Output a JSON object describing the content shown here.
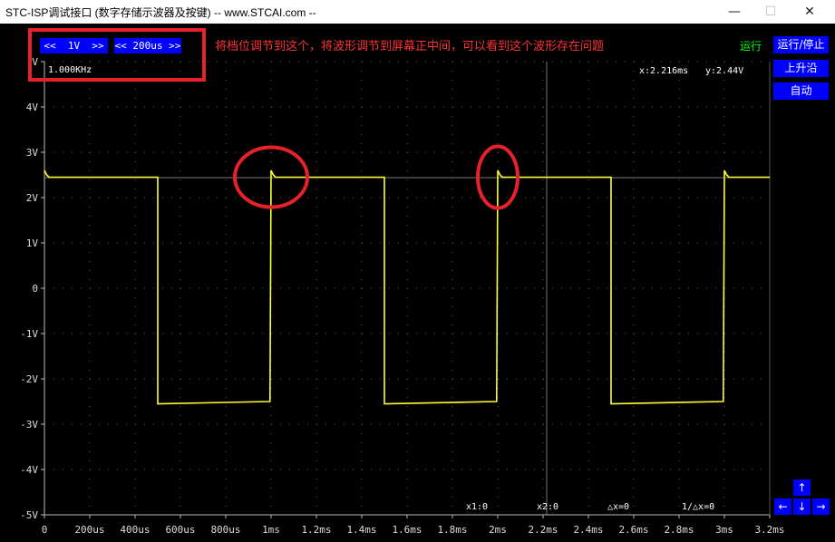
{
  "window": {
    "title": "STC-ISP调试接口 (数字存储示波器及按键) -- www.STCAI.com --",
    "minimize": "—",
    "maximize": "☐",
    "close": "✕"
  },
  "controls": {
    "volt_div": "<<  1V  >>",
    "time_div": "<< 200us >>"
  },
  "annotation": "将档位调节到这个，将波形调节到屏幕正中间，可以看到这个波形存在问题",
  "status": "运行",
  "side_buttons": {
    "run_stop": "运行/停止",
    "edge": "上升沿",
    "auto": "自动"
  },
  "arrows": {
    "up": "↑",
    "left": "←",
    "down": "↓",
    "right": "→"
  },
  "readouts": {
    "frequency": "1.000KHz",
    "x": "x:2.216ms",
    "y": "y:2.44V",
    "x1": "x1:0",
    "x2": "x2:0",
    "dx": "△x=0",
    "inv_dx": "1/△x=0"
  },
  "colors": {
    "trace": "#ffff33",
    "grid": "#5a5a5a",
    "button": "#0000ff",
    "highlight": "#e8212b",
    "status": "#00ff00"
  },
  "chart_data": {
    "type": "line",
    "title": "",
    "xlabel": "",
    "ylabel": "",
    "y_unit_label": "V",
    "xlim": [
      0,
      3.2
    ],
    "ylim": [
      -5,
      5
    ],
    "x_ticks": [
      "0",
      "200us",
      "400us",
      "600us",
      "800us",
      "1ms",
      "1.2ms",
      "1.4ms",
      "1.6ms",
      "1.8ms",
      "2ms",
      "2.2ms",
      "2.4ms",
      "2.6ms",
      "2.8ms",
      "3ms",
      "3.2ms"
    ],
    "y_ticks": [
      "-5V",
      "-4V",
      "-3V",
      "-2V",
      "-1V",
      "0",
      "1V",
      "2V",
      "3V",
      "4V"
    ],
    "grid": true,
    "series": [
      {
        "x": [
          0.0,
          0.01,
          0.02,
          0.5,
          0.5,
          0.995,
          1.0,
          1.01,
          1.02,
          1.5,
          1.5,
          1.995,
          2.0,
          2.01,
          2.02,
          2.5,
          2.5,
          2.995,
          3.0,
          3.01,
          3.02,
          3.2
        ],
        "y": [
          2.6,
          2.5,
          2.45,
          2.45,
          -2.55,
          -2.5,
          2.6,
          2.5,
          2.45,
          2.45,
          -2.55,
          -2.5,
          2.6,
          2.5,
          2.45,
          2.45,
          -2.55,
          -2.5,
          2.6,
          2.5,
          2.45,
          2.45
        ]
      }
    ],
    "cursor": {
      "x": 2.216,
      "y": 2.44
    }
  }
}
